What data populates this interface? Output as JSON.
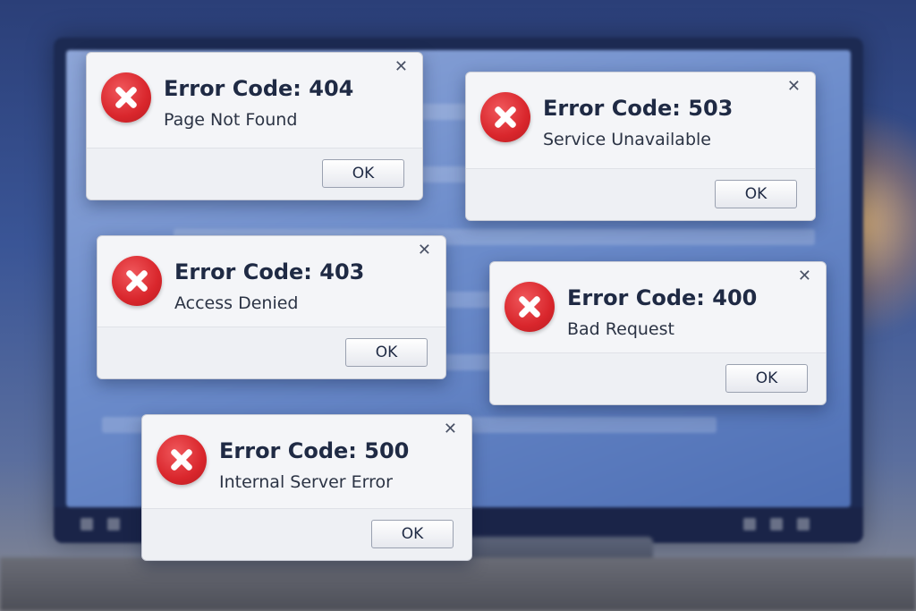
{
  "dialogs": [
    {
      "title": "Error Code: 404",
      "message": "Page Not Found",
      "ok_label": "OK",
      "close_glyph": "✕",
      "icon": "error-x-icon"
    },
    {
      "title": "Error Code: 503",
      "message": "Service Unavailable",
      "ok_label": "OK",
      "close_glyph": "✕",
      "icon": "error-x-icon"
    },
    {
      "title": "Error Code: 403",
      "message": "Access Denied",
      "ok_label": "OK",
      "close_glyph": "✕",
      "icon": "error-x-icon"
    },
    {
      "title": "Error Code: 400",
      "message": "Bad Request",
      "ok_label": "OK",
      "close_glyph": "✕",
      "icon": "error-x-icon"
    },
    {
      "title": "Error Code: 500",
      "message": "Internal Server Error",
      "ok_label": "OK",
      "close_glyph": "✕",
      "icon": "error-x-icon"
    }
  ],
  "colors": {
    "error_red": "#d9262c",
    "dialog_bg": "#f4f5f8",
    "background_blue": "#3a5596"
  }
}
